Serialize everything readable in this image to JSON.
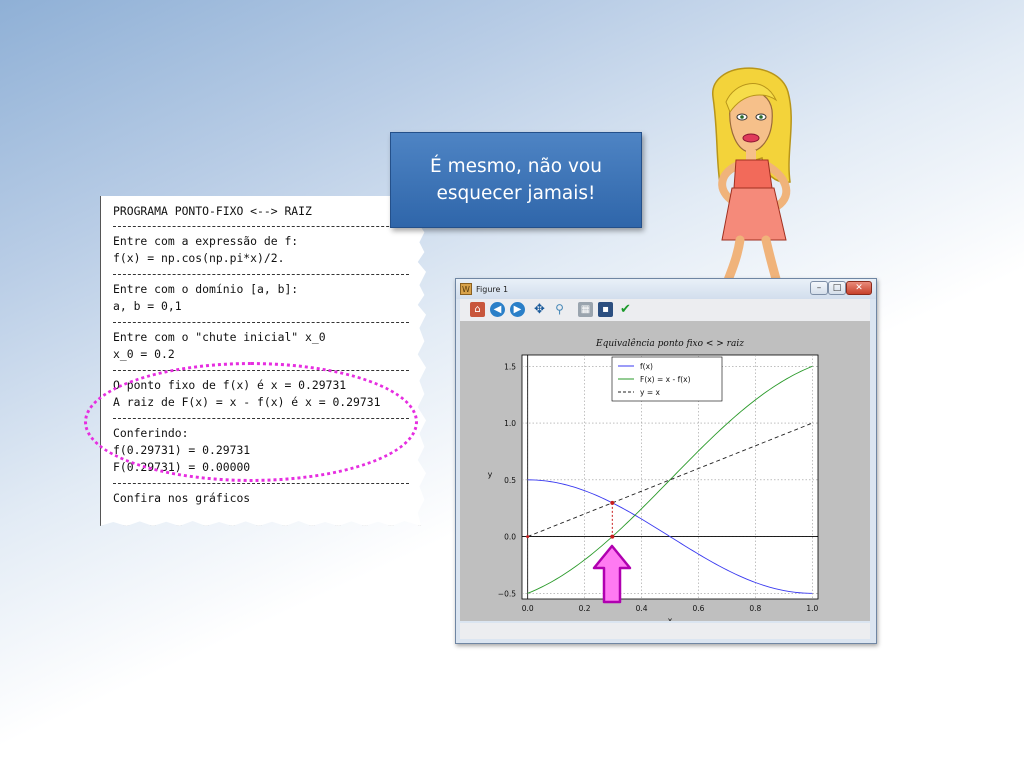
{
  "console": {
    "header": "PROGRAMA PONTO-FIXO <--> RAIZ",
    "expr_prompt": "Entre com a expressão de f:",
    "expr_value": "f(x) = np.cos(np.pi*x)/2.",
    "domain_prompt": "Entre com o domínio [a, b]:",
    "domain_value": "a, b = 0,1",
    "guess_prompt": "Entre com o \"chute inicial\" x_0",
    "guess_value": "x_0 = 0.2",
    "fixed_point_result": "O ponto fixo de f(x) é x = 0.29731",
    "root_result": "A raiz de F(x) = x - f(x) é x = 0.29731",
    "check_title": "Conferindo:",
    "check_f": "f(0.29731) = 0.29731",
    "check_F": "F(0.29731) = 0.00000",
    "footer": "Confira nos gráficos"
  },
  "bubble": {
    "line1": "É mesmo, não vou",
    "line2": "esquecer jamais!"
  },
  "figure_window": {
    "title": "Figure 1",
    "app_icon_letter": "W",
    "minimize": "–",
    "maximize": "□",
    "close": "✕",
    "toolbar_icons": [
      "home-icon",
      "back-icon",
      "forward-icon",
      "pan-icon",
      "zoom-icon",
      "subplots-icon",
      "save-icon",
      "check-icon"
    ]
  },
  "colors": {
    "highlight": "#e62ee0",
    "bubble": "#3a72b8",
    "series_f": "#3a3af0",
    "series_F": "#2a9a2a",
    "series_identity": "#222222",
    "marker": "#c81e1e",
    "arrow_fill": "#ff7af2",
    "arrow_stroke": "#b000b0"
  },
  "chart_data": {
    "type": "line",
    "title": "Equivalência ponto  fixo <  > raiz",
    "xlabel": "x",
    "ylabel": "y",
    "xlim": [
      -0.02,
      1.02
    ],
    "ylim": [
      -0.55,
      1.6
    ],
    "xticks": [
      "0.0",
      "0.2",
      "0.4",
      "0.6",
      "0.8",
      "1.0"
    ],
    "yticks": [
      "−0.5",
      "0.0",
      "0.5",
      "1.0",
      "1.5"
    ],
    "xtick_values": [
      0.0,
      0.2,
      0.4,
      0.6,
      0.8,
      1.0
    ],
    "ytick_values": [
      -0.5,
      0.0,
      0.5,
      1.0,
      1.5
    ],
    "grid": true,
    "legend_position": "top-center",
    "series": [
      {
        "name": "f(x)",
        "formula": "cos(pi*x)/2",
        "x_range": [
          0,
          1
        ]
      },
      {
        "name": "F(x) = x - f(x)",
        "formula": "x - cos(pi*x)/2",
        "x_range": [
          0,
          1
        ]
      },
      {
        "name": "y = x",
        "formula": "x",
        "x_range": [
          0,
          1
        ]
      }
    ],
    "fixed_point": {
      "x": 0.29731,
      "y": 0.29731
    }
  }
}
